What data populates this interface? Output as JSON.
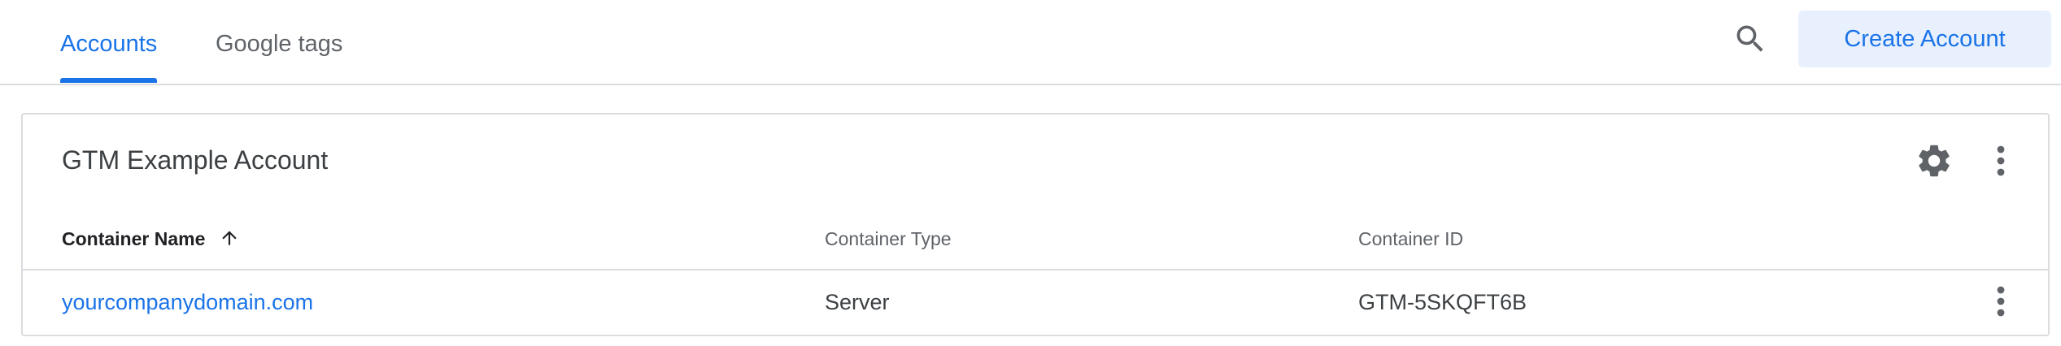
{
  "tabs": [
    {
      "label": "Accounts",
      "active": true
    },
    {
      "label": "Google tags",
      "active": false
    }
  ],
  "header": {
    "search_icon": "search-icon",
    "create_button_label": "Create Account"
  },
  "account": {
    "name": "GTM Example Account",
    "settings_icon": "gear-icon",
    "more_icon": "more-vert-icon",
    "table": {
      "columns": [
        {
          "label": "Container Name",
          "sort": "ascending"
        },
        {
          "label": "Container Type"
        },
        {
          "label": "Container ID"
        }
      ],
      "rows": [
        {
          "name": "yourcompanydomain.com",
          "type": "Server",
          "id": "GTM-5SKQFT6B"
        }
      ]
    }
  },
  "colors": {
    "accent": "#1a73e8",
    "accent_bg": "#e8f0fe",
    "divider": "#dadce0",
    "icon": "#5f6368"
  }
}
